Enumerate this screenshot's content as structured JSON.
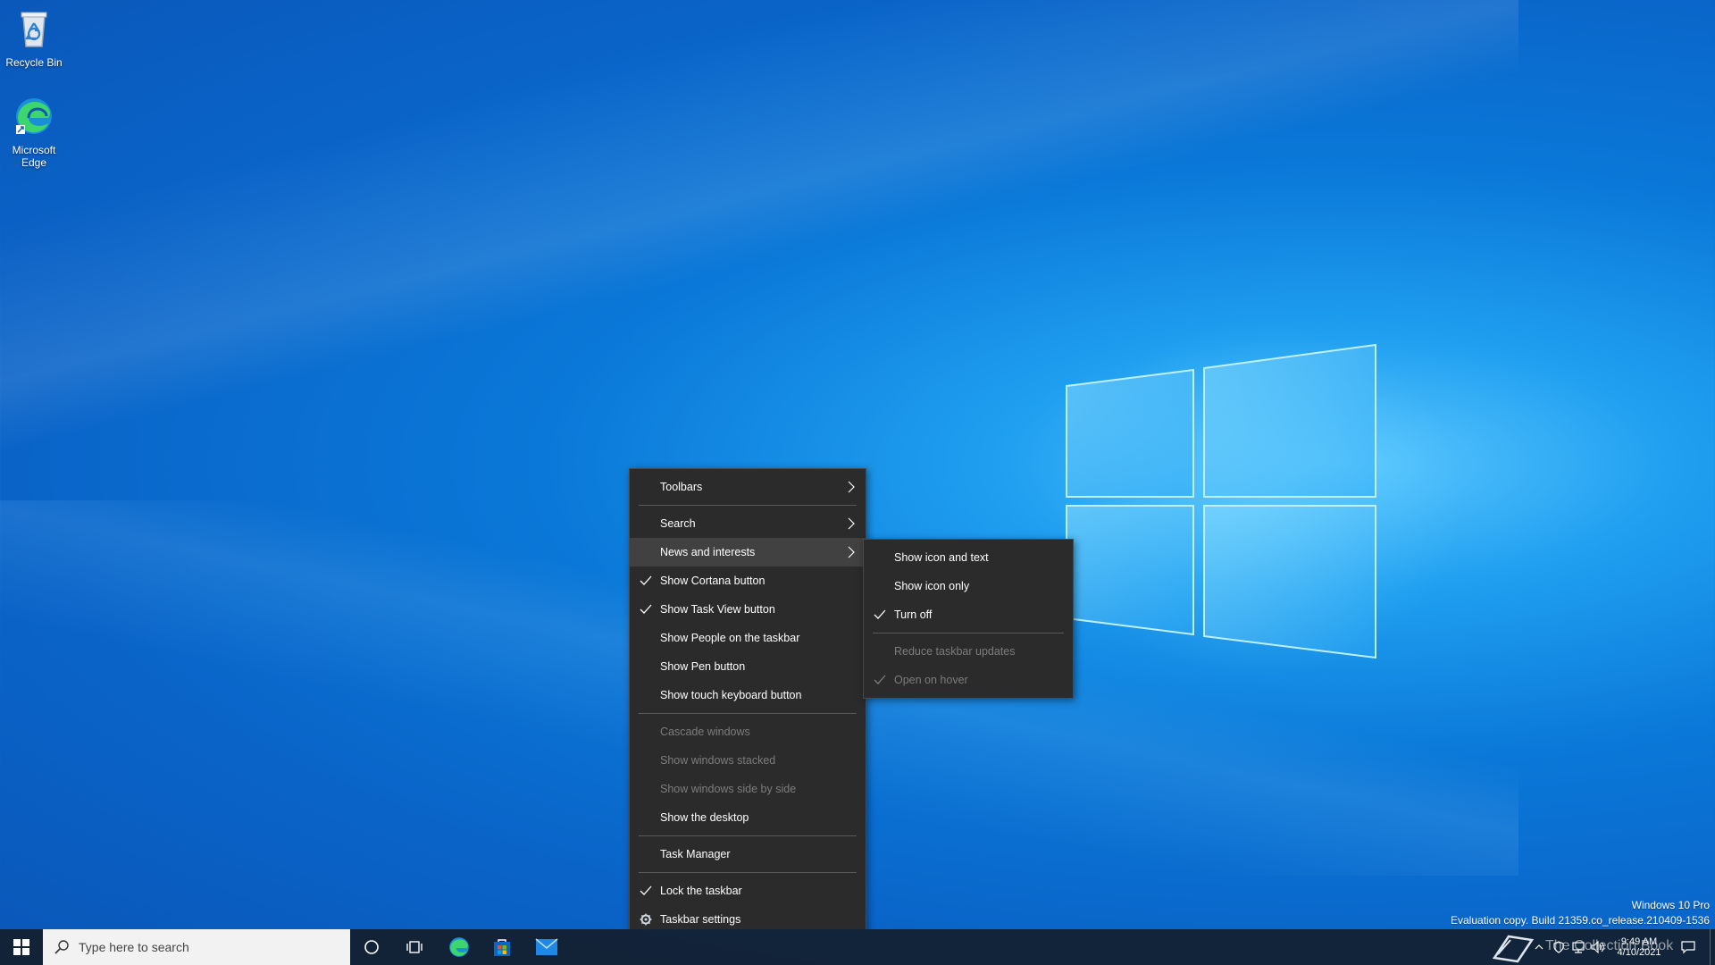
{
  "desktop": {
    "icons": [
      {
        "label": "Recycle Bin"
      },
      {
        "label": "Microsoft Edge"
      }
    ],
    "watermark": {
      "line1": "Windows 10 Pro",
      "line2": "Evaluation copy. Build 21359.co_release.210409-1536"
    },
    "overlay_text": "The Collection Book"
  },
  "context_menu": {
    "items": [
      {
        "label": "Toolbars"
      },
      {
        "label": "Search"
      },
      {
        "label": "News and interests"
      },
      {
        "label": "Show Cortana button"
      },
      {
        "label": "Show Task View button"
      },
      {
        "label": "Show People on the taskbar"
      },
      {
        "label": "Show Pen button"
      },
      {
        "label": "Show touch keyboard button"
      },
      {
        "label": "Cascade windows"
      },
      {
        "label": "Show windows stacked"
      },
      {
        "label": "Show windows side by side"
      },
      {
        "label": "Show the desktop"
      },
      {
        "label": "Task Manager"
      },
      {
        "label": "Lock the taskbar"
      },
      {
        "label": "Taskbar settings"
      }
    ]
  },
  "submenu": {
    "items": [
      {
        "label": "Show icon and text"
      },
      {
        "label": "Show icon only"
      },
      {
        "label": "Turn off"
      },
      {
        "label": "Reduce taskbar updates"
      },
      {
        "label": "Open on hover"
      }
    ]
  },
  "taskbar": {
    "search_placeholder": "Type here to search",
    "time": "9:49 AM",
    "date": "4/10/2021"
  },
  "colors": {
    "menu_bg": "#2b2b2b",
    "menu_hover": "#414141",
    "taskbar_bg": "#1c2736",
    "desktop_accent": "#0a78d8"
  }
}
